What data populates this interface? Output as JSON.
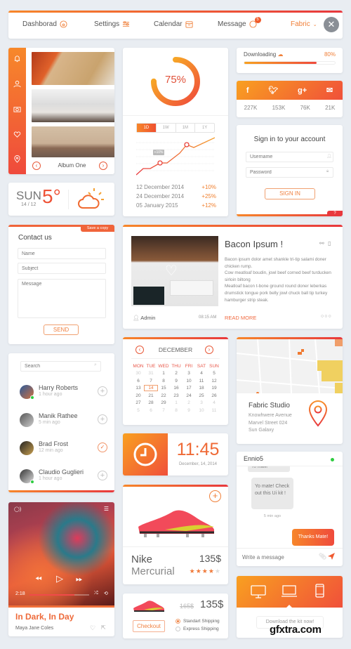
{
  "nav": {
    "items": [
      {
        "label": "Dashborad",
        "icon": "dashboard-icon"
      },
      {
        "label": "Settings",
        "icon": "sliders-icon"
      },
      {
        "label": "Calendar",
        "icon": "calendar-icon"
      },
      {
        "label": "Message",
        "icon": "chat-icon",
        "badge": "5"
      }
    ],
    "user_menu": "Fabric",
    "accent": "#f0803a"
  },
  "album": {
    "sidebar_icons": [
      "bell-icon",
      "user-icon",
      "camera-icon",
      "heart-icon",
      "location-icon"
    ],
    "title": "Album One"
  },
  "weather": {
    "day": "SUN",
    "date": "14 / 12",
    "temp": "5°",
    "icon": "partly-sunny-icon"
  },
  "progress_widget": {
    "value_label": "75%",
    "value": 0.75,
    "ranges": [
      "1D",
      "1W",
      "1M",
      "1Y"
    ],
    "active_range": "1D",
    "tooltip": "+10%",
    "entries": [
      {
        "date": "12 December 2014",
        "change": "+10%"
      },
      {
        "date": "24 December 2014",
        "change": "+25%"
      },
      {
        "date": "05 January 2015",
        "change": "+12%"
      }
    ]
  },
  "download": {
    "label": "Downloading",
    "percent_label": "80%",
    "progress": 0.8
  },
  "social": [
    {
      "network": "facebook-icon",
      "glyph": "f",
      "count": "227K"
    },
    {
      "network": "twitter-icon",
      "glyph": "t",
      "count": "153K"
    },
    {
      "network": "google-plus-icon",
      "glyph": "g+",
      "count": "76K"
    },
    {
      "network": "mail-icon",
      "glyph": "✉",
      "count": "21K"
    }
  ],
  "signin": {
    "title": "Sign in to your account",
    "username_placeholder": "Username",
    "password_placeholder": "Password",
    "button": "SIGN IN",
    "help": "?"
  },
  "contact": {
    "title": "Contact us",
    "save_badge": "Save a copy",
    "name_placeholder": "Name",
    "subject_placeholder": "Subject",
    "message_placeholder": "Message",
    "button": "SEND"
  },
  "blog": {
    "title": "Bacon Ipsum !",
    "body": [
      "Bacon ipsum dolor amet shankle tri-tip salami doner chicken rump.",
      "Cow meatloaf boudin, jowl beef corned beef turducken sirloin biltong",
      "Meatloaf bacon t-bone ground round doner leberkas drumstick tongue pork belly jowl chuck ball tip turkey hamburger strip steak."
    ],
    "author": "Admin",
    "time": "08:15 AM",
    "read_more": "READ MORE"
  },
  "calendar": {
    "month": "DECEMBER",
    "weekdays": [
      "MON",
      "TUE",
      "WED",
      "THU",
      "FRI",
      "SAT",
      "SUN"
    ],
    "weeks": [
      [
        "30",
        "31",
        "1",
        "2",
        "3",
        "4",
        "5"
      ],
      [
        "6",
        "7",
        "8",
        "9",
        "10",
        "11",
        "12"
      ],
      [
        "13",
        "14",
        "15",
        "16",
        "17",
        "18",
        "19"
      ],
      [
        "20",
        "21",
        "22",
        "23",
        "24",
        "25",
        "26"
      ],
      [
        "27",
        "28",
        "29",
        "1",
        "2",
        "3",
        "4"
      ],
      [
        "5",
        "6",
        "7",
        "8",
        "9",
        "10",
        "11"
      ]
    ],
    "today": "14"
  },
  "map": {
    "name": "Fabric Studio",
    "address": [
      "Knowhwere Avenue",
      "Marvel Street 024",
      "Sun Galaxy"
    ]
  },
  "people": {
    "search_placeholder": "Search",
    "list": [
      {
        "name": "Harry Roberts",
        "time": "1 hour ago",
        "online": true,
        "added": false
      },
      {
        "name": "Manik Rathee",
        "time": "5 min ago",
        "online": false,
        "added": false
      },
      {
        "name": "Brad Frost",
        "time": "12 min ago",
        "online": false,
        "added": true
      },
      {
        "name": "Claudio Guglieri",
        "time": "1 hour ago",
        "online": true,
        "added": false
      }
    ]
  },
  "clock": {
    "time": "11:45",
    "date": "December, 14, 2014"
  },
  "product": {
    "brand": "Nike",
    "model": "Mercurial",
    "price": "135$",
    "rating": 4,
    "rating_max": 5
  },
  "chat": {
    "contact": "Ennio5",
    "messages": [
      {
        "from": "them",
        "text": "Yo mate!"
      },
      {
        "from": "them",
        "text": "Yo mate! Check out this Ui kit !"
      },
      {
        "from": "me",
        "text": "Thanks Mate!"
      }
    ],
    "timestamp": "5 min ago",
    "input_placeholder": "Write a message"
  },
  "music": {
    "title": "In Dark, In Day",
    "artist": "Maya Jane Coles",
    "elapsed": "2:18",
    "progress": 0.75
  },
  "checkout": {
    "old_price": "165$",
    "price": "135$",
    "button": "Checkout",
    "shipping_options": [
      "Standart Shipping",
      "Express Shipping"
    ],
    "selected": "Standart Shipping"
  },
  "devices": {
    "icons": [
      "desktop-icon",
      "laptop-icon",
      "tablet-icon"
    ],
    "button": "Download the kit now!"
  },
  "watermark": "gfxtra.com"
}
